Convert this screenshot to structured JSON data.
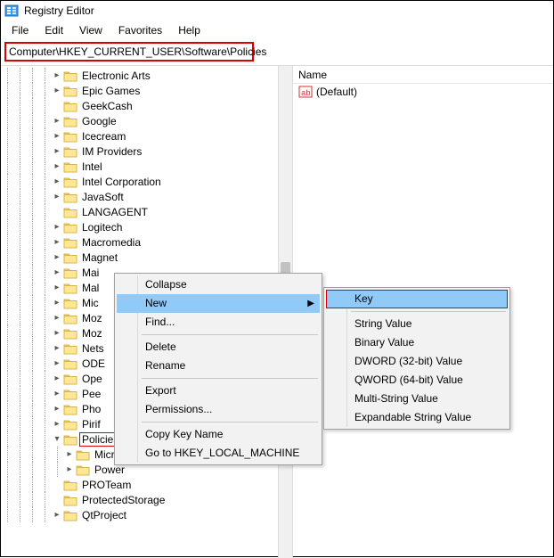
{
  "title": "Registry Editor",
  "menubar": {
    "items": [
      "File",
      "Edit",
      "View",
      "Favorites",
      "Help"
    ]
  },
  "address": "Computer\\HKEY_CURRENT_USER\\Software\\Policies",
  "tree": {
    "items": [
      {
        "label": "Electronic Arts",
        "expander": ">",
        "depth": 4
      },
      {
        "label": "Epic Games",
        "expander": ">",
        "depth": 4
      },
      {
        "label": "GeekCash",
        "expander": "",
        "depth": 4
      },
      {
        "label": "Google",
        "expander": ">",
        "depth": 4
      },
      {
        "label": "Icecream",
        "expander": ">",
        "depth": 4
      },
      {
        "label": "IM Providers",
        "expander": ">",
        "depth": 4
      },
      {
        "label": "Intel",
        "expander": ">",
        "depth": 4
      },
      {
        "label": "Intel Corporation",
        "expander": ">",
        "depth": 4
      },
      {
        "label": "JavaSoft",
        "expander": ">",
        "depth": 4
      },
      {
        "label": "LANGAGENT",
        "expander": "",
        "depth": 4
      },
      {
        "label": "Logitech",
        "expander": ">",
        "depth": 4
      },
      {
        "label": "Macromedia",
        "expander": ">",
        "depth": 4
      },
      {
        "label": "Magnet",
        "expander": ">",
        "depth": 4
      },
      {
        "label": "Mai",
        "expander": ">",
        "depth": 4,
        "trunc": true
      },
      {
        "label": "Mal",
        "expander": ">",
        "depth": 4,
        "trunc": true
      },
      {
        "label": "Mic",
        "expander": ">",
        "depth": 4,
        "trunc": true
      },
      {
        "label": "Moz",
        "expander": ">",
        "depth": 4,
        "trunc": true
      },
      {
        "label": "Moz",
        "expander": ">",
        "depth": 4,
        "trunc": true
      },
      {
        "label": "Nets",
        "expander": ">",
        "depth": 4,
        "trunc": true
      },
      {
        "label": "ODE",
        "expander": ">",
        "depth": 4,
        "trunc": true
      },
      {
        "label": "Ope",
        "expander": ">",
        "depth": 4,
        "trunc": true
      },
      {
        "label": "Pee",
        "expander": ">",
        "depth": 4,
        "trunc": true
      },
      {
        "label": "Pho",
        "expander": ">",
        "depth": 4,
        "trunc": true
      },
      {
        "label": "Pirif",
        "expander": ">",
        "depth": 4,
        "trunc": true
      },
      {
        "label": "Policies",
        "expander": "v",
        "depth": 4,
        "selected": true
      },
      {
        "label": "Microsoft",
        "expander": ">",
        "depth": 5
      },
      {
        "label": "Power",
        "expander": ">",
        "depth": 5
      },
      {
        "label": "PROTeam",
        "expander": "",
        "depth": 4
      },
      {
        "label": "ProtectedStorage",
        "expander": "",
        "depth": 4
      },
      {
        "label": "QtProject",
        "expander": ">",
        "depth": 4
      }
    ]
  },
  "valuePane": {
    "header": "Name",
    "default_label": "(Default)"
  },
  "ctx": {
    "items": [
      {
        "label": "Collapse",
        "type": "item"
      },
      {
        "label": "New",
        "type": "item",
        "hl": true,
        "submenu": true
      },
      {
        "label": "Find...",
        "type": "item"
      },
      {
        "type": "sep"
      },
      {
        "label": "Delete",
        "type": "item"
      },
      {
        "label": "Rename",
        "type": "item"
      },
      {
        "type": "sep"
      },
      {
        "label": "Export",
        "type": "item"
      },
      {
        "label": "Permissions...",
        "type": "item"
      },
      {
        "type": "sep"
      },
      {
        "label": "Copy Key Name",
        "type": "item"
      },
      {
        "label": "Go to HKEY_LOCAL_MACHINE",
        "type": "item"
      }
    ]
  },
  "subctx": {
    "items": [
      {
        "label": "Key",
        "hl": true
      },
      {
        "type": "sep"
      },
      {
        "label": "String Value"
      },
      {
        "label": "Binary Value"
      },
      {
        "label": "DWORD (32-bit) Value"
      },
      {
        "label": "QWORD (64-bit) Value"
      },
      {
        "label": "Multi-String Value"
      },
      {
        "label": "Expandable String Value"
      }
    ]
  }
}
